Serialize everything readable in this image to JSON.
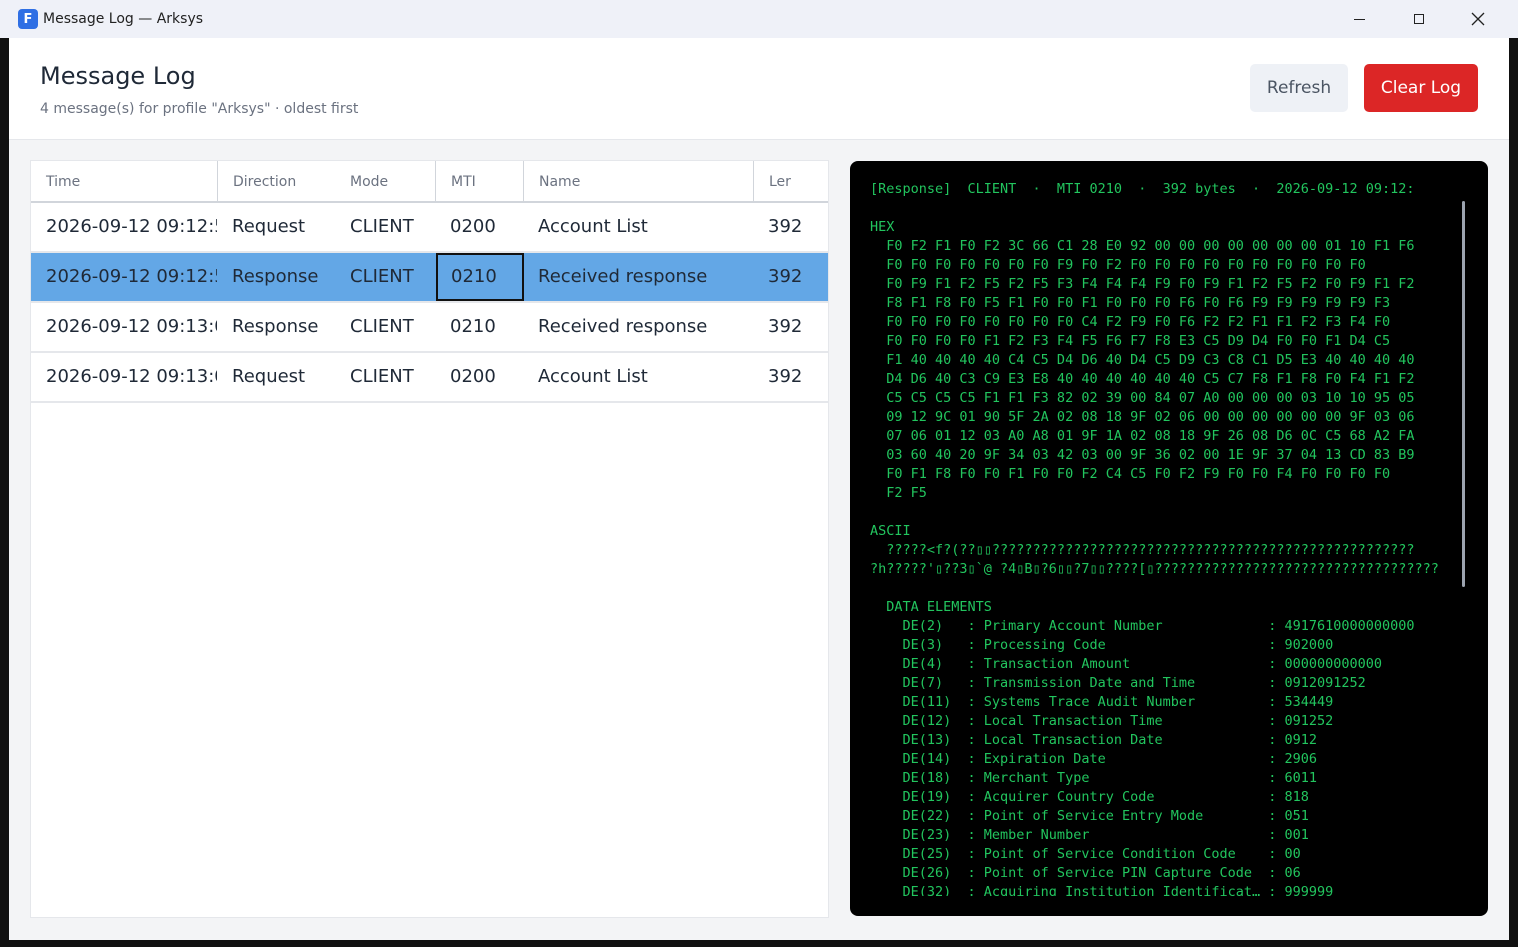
{
  "window": {
    "title": "Message Log — Arksys",
    "app_icon_letter": "F"
  },
  "header": {
    "title": "Message Log",
    "subtitle": "4 message(s) for profile \"Arksys\" · oldest first",
    "refresh_label": "Refresh",
    "clear_label": "Clear Log"
  },
  "colors": {
    "accent": "#2f6fe4",
    "danger": "#dc2626",
    "selected_row": "#63a7e6",
    "terminal_text": "#22c55e",
    "terminal_bg": "#000000"
  },
  "table": {
    "columns": [
      "Time",
      "Direction",
      "Mode",
      "MTI",
      "Name",
      "Ler"
    ],
    "rows": [
      {
        "time": "2026-09-12 09:12:5",
        "direction": "Request",
        "mode": "CLIENT",
        "mti": "0200",
        "name": "Account List",
        "length": "392"
      },
      {
        "time": "2026-09-12 09:12:5",
        "direction": "Response",
        "mode": "CLIENT",
        "mti": "0210",
        "name": "Received response",
        "length": "392"
      },
      {
        "time": "2026-09-12 09:13:0",
        "direction": "Response",
        "mode": "CLIENT",
        "mti": "0210",
        "name": "Received response",
        "length": "392"
      },
      {
        "time": "2026-09-12 09:13:0",
        "direction": "Request",
        "mode": "CLIENT",
        "mti": "0200",
        "name": "Account List",
        "length": "392"
      }
    ]
  },
  "detail": {
    "lines": [
      "[Response]  CLIENT  ·  MTI 0210  ·  392 bytes  ·  2026-09-12 09:12:",
      "",
      "HEX",
      "  F0 F2 F1 F0 F2 3C 66 C1 28 E0 92 00 00 00 00 00 00 00 01 10 F1 F6",
      "  F0 F0 F0 F0 F0 F0 F0 F9 F0 F2 F0 F0 F0 F0 F0 F0 F0 F0 F0 F0",
      "  F0 F9 F1 F2 F5 F2 F5 F3 F4 F4 F4 F9 F0 F9 F1 F2 F5 F2 F0 F9 F1 F2",
      "  F8 F1 F8 F0 F5 F1 F0 F0 F1 F0 F0 F0 F6 F0 F6 F9 F9 F9 F9 F9 F3",
      "  F0 F0 F0 F0 F0 F0 F0 F0 C4 F2 F9 F0 F6 F2 F2 F1 F1 F2 F3 F4 F0",
      "  F0 F0 F0 F0 F1 F2 F3 F4 F5 F6 F7 F8 E3 C5 D9 D4 F0 F0 F1 D4 C5",
      "  F1 40 40 40 40 C4 C5 D4 D6 40 D4 C5 D9 C3 C8 C1 D5 E3 40 40 40 40",
      "  D4 D6 40 C3 C9 E3 E8 40 40 40 40 40 40 C5 C7 F8 F1 F8 F0 F4 F1 F2",
      "  C5 C5 C5 C5 F1 F1 F3 82 02 39 00 84 07 A0 00 00 00 03 10 10 95 05",
      "  09 12 9C 01 90 5F 2A 02 08 18 9F 02 06 00 00 00 00 00 00 9F 03 06",
      "  07 06 01 12 03 A0 A8 01 9F 1A 02 08 18 9F 26 08 D6 0C C5 68 A2 FA",
      "  03 60 40 20 9F 34 03 42 03 00 9F 36 02 00 1E 9F 37 04 13 CD 83 B9",
      "  F0 F1 F8 F0 F0 F1 F0 F0 F2 C4 C5 F0 F2 F9 F0 F0 F4 F0 F0 F0 F0",
      "  F2 F5",
      "",
      "ASCII",
      "  ?????<f?(??▯▯????????????????????????????????????????????????????",
      "?h?????'▯??3▯`@ ?4▯B▯?6▯▯?7▯▯????[▯???????????????????????????????????",
      "",
      "  DATA ELEMENTS",
      "    DE(2)   : Primary Account Number             : 4917610000000000",
      "    DE(3)   : Processing Code                    : 902000",
      "    DE(4)   : Transaction Amount                 : 000000000000",
      "    DE(7)   : Transmission Date and Time         : 0912091252",
      "    DE(11)  : Systems Trace Audit Number         : 534449",
      "    DE(12)  : Local Transaction Time             : 091252",
      "    DE(13)  : Local Transaction Date             : 0912",
      "    DE(14)  : Expiration Date                    : 2906",
      "    DE(18)  : Merchant Type                      : 6011",
      "    DE(19)  : Acquirer Country Code              : 818",
      "    DE(22)  : Point of Service Entry Mode        : 051",
      "    DE(23)  : Member Number                      : 001",
      "    DE(25)  : Point of Service Condition Code    : 00",
      "    DE(26)  : Point of Service PIN Capture Code  : 06",
      "    DE(32)  : Acquiring Institution Identificat… : 999999"
    ]
  }
}
